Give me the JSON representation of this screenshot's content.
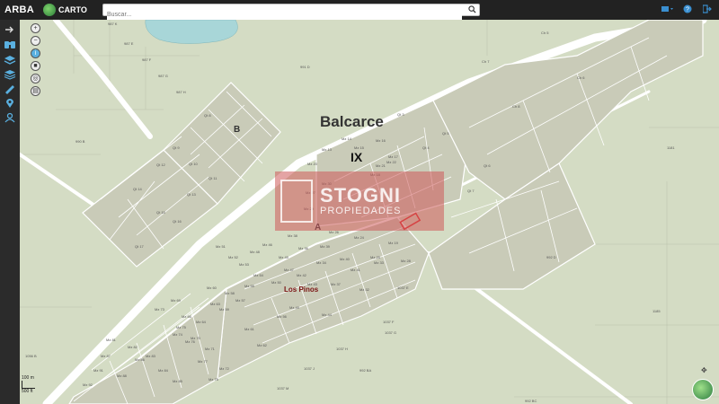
{
  "header": {
    "brand": "ARBA",
    "carto": "CARTO",
    "search_placeholder": "Buscar..."
  },
  "sidebar": {
    "items": [
      {
        "name": "search-parcel",
        "icon": "binoculars-icon"
      },
      {
        "name": "layers",
        "icon": "layers-icon"
      },
      {
        "name": "layers-stack",
        "icon": "stack-icon"
      },
      {
        "name": "measure",
        "icon": "ruler-icon"
      },
      {
        "name": "location",
        "icon": "pin-icon"
      },
      {
        "name": "user",
        "icon": "user-icon"
      }
    ]
  },
  "map": {
    "town": "Balcarce",
    "section_roman": "IX",
    "section_b": "B",
    "section_a": "A",
    "barrio": "Los Pinos",
    "watermark_big": "STOGNI",
    "watermark_small": "PROPIEDADES",
    "labels": [
      "987 K",
      "987 E",
      "987 F",
      "987 G",
      "987 H",
      "991 D",
      "990 B",
      "Qt 8",
      "Qt 9",
      "Qt 10",
      "Qt 11",
      "Qt 12",
      "Qt 13",
      "Qt 14",
      "Qt 15",
      "Qt 16",
      "Qt 17",
      "Qt 3",
      "Qt 4",
      "Qt 5",
      "Qt 6",
      "Qt 7",
      "Ch 5",
      "Ch 6",
      "Ch 7",
      "Ch 8",
      "1181",
      "992 D",
      "1185",
      "1037 E",
      "1037 F",
      "1037 G",
      "1037 H",
      "1037 J",
      "992 BA",
      "1037 M",
      "992 BC",
      "1056 B",
      "Mz 13",
      "Mz 14",
      "Mz 15",
      "Mz 16",
      "Mz 17",
      "Mz 18",
      "Mz 19",
      "Mz 20",
      "Mz 21",
      "Mz 22",
      "Mz 24",
      "Mz 25",
      "Mz 26",
      "Mz 27",
      "Mz 28",
      "Mz 29",
      "Mz 30",
      "Mz 32",
      "Mz 33",
      "Mz 34",
      "Mz 36",
      "Mz 37",
      "Mz 38",
      "Mz 39",
      "Mz 40",
      "Mz 41",
      "Mz 42",
      "Mz 43",
      "Mz 44",
      "Mz 45",
      "Mz 46",
      "Mz 47",
      "Mz 48",
      "Mz 49",
      "Mz 50",
      "Mz 51",
      "Mz 52",
      "Mz 53",
      "Mz 54",
      "Mz 55",
      "Mz 56",
      "Mz 57",
      "Mz 58",
      "Mz 59",
      "Mz 60",
      "Mz 61",
      "Mz 62",
      "Mz 63",
      "Mz 64",
      "Mz 66",
      "Mz 69",
      "Mz 70",
      "Mz 71",
      "Mz 72",
      "Mz 73",
      "Mz 74",
      "Mz 75",
      "Mz 76",
      "Mz 77",
      "Mz 78",
      "Mz 81",
      "Mz 82",
      "Mz 83",
      "Mz 84",
      "Mz 85",
      "Mz 86",
      "Mz 87",
      "Mz 88",
      "Mz 91",
      "Mz 92"
    ]
  },
  "scale": {
    "top": "100 m",
    "bottom": "500 ft"
  },
  "colors": {
    "topbar": "#222222",
    "sidebar": "#2b2b2b",
    "map_bg": "#d4dcc4",
    "block": "#c9cbb8",
    "road": "#ffffff",
    "highlight": "#e0282a",
    "water": "#a8d6d8"
  }
}
